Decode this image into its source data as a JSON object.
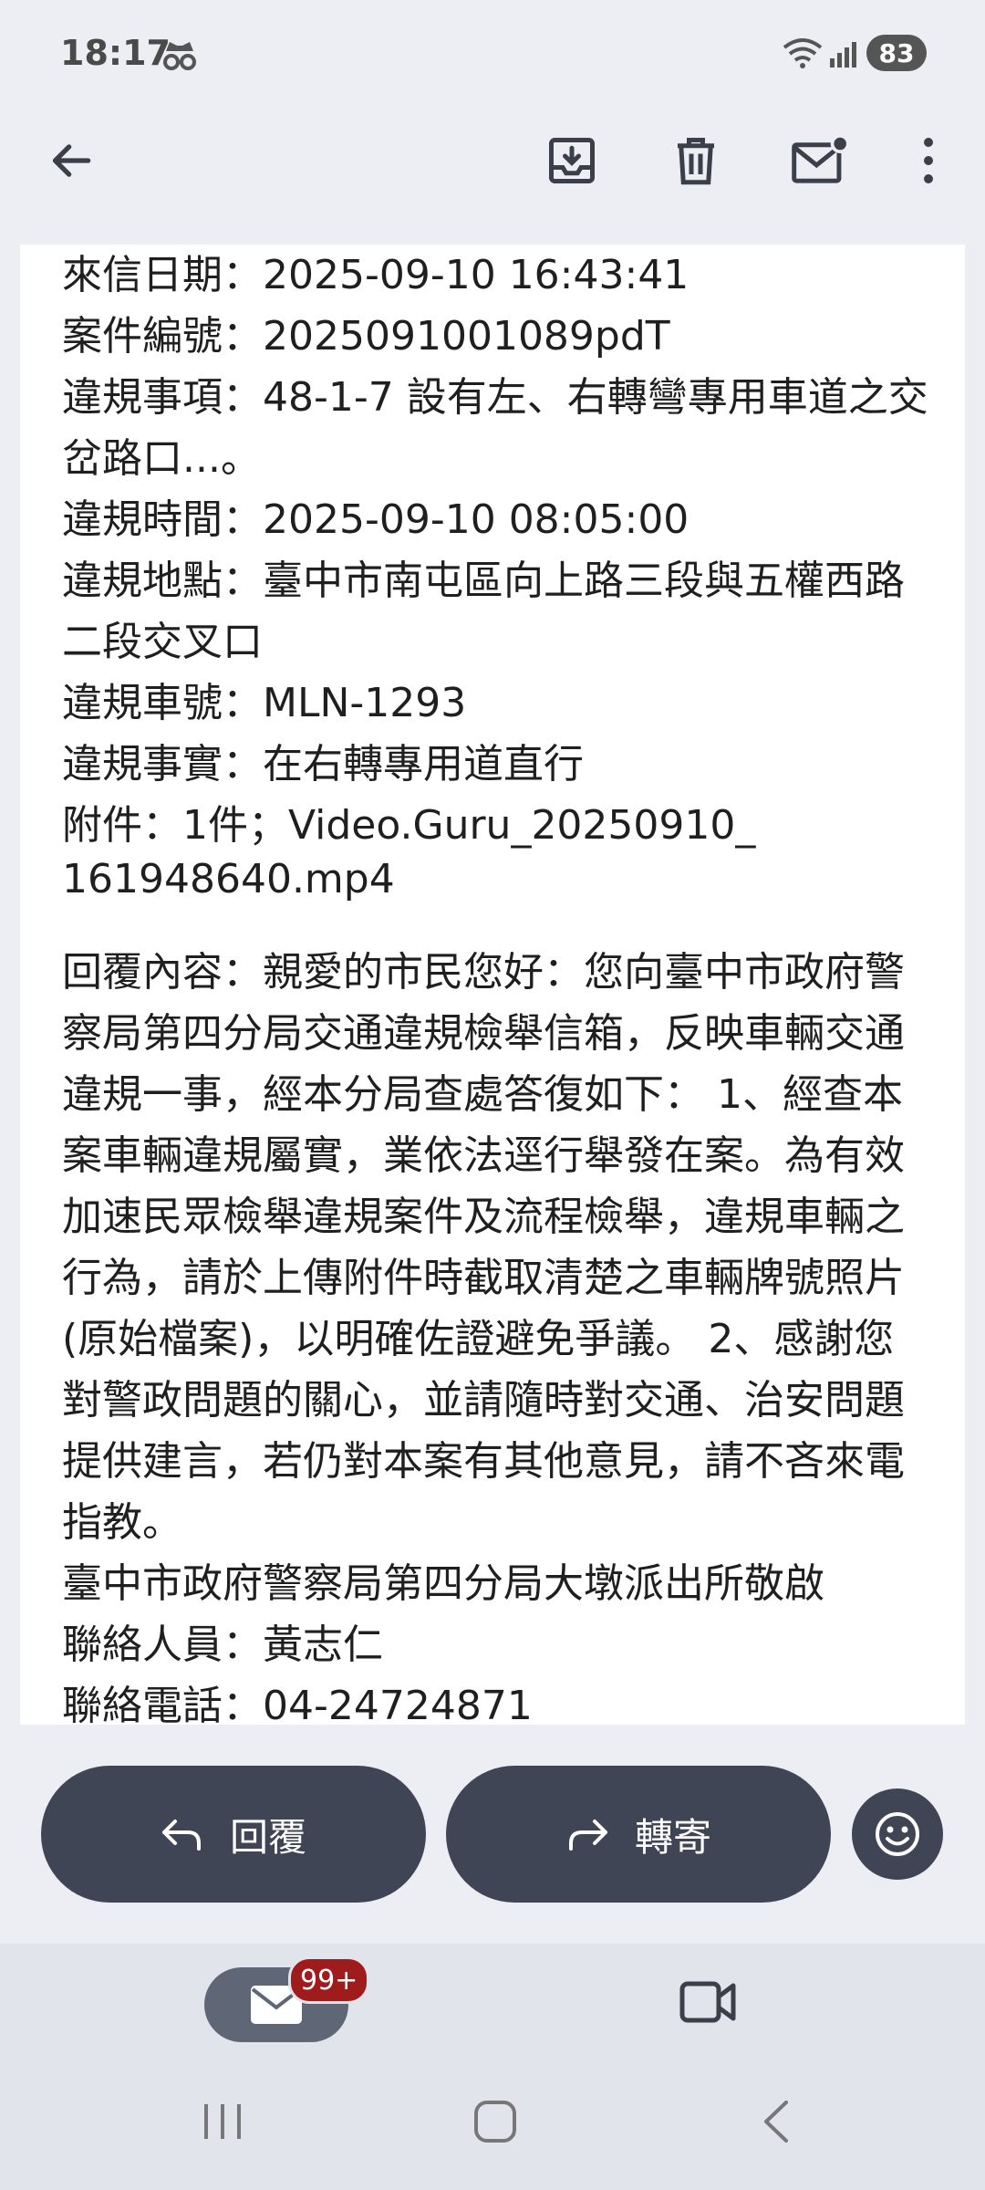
{
  "status_bar": {
    "time": "18:17",
    "battery": "83",
    "icons": [
      "incognito-icon",
      "wifi-icon",
      "signal-icon"
    ]
  },
  "app_bar": {
    "icons": [
      "back-arrow-icon",
      "archive-icon",
      "delete-icon",
      "mark-unread-icon",
      "more-vert-icon"
    ]
  },
  "email": {
    "lines": [
      "來信日期：2025-09-10 16:43:41",
      "案件編號：2025091001089pdT",
      "違規事項：48-1-7 設有左、右轉彎專用車道之交",
      "岔路口...。",
      "違規時間：2025-09-10 08:05:00",
      "違規地點：臺中市南屯區向上路三段與五權西路",
      "二段交叉口",
      "違規車號：MLN-1293",
      "違規事實：在右轉專用道直行",
      "附件：1件；Video.Guru_20250910_",
      "161948640.mp4"
    ],
    "reply_lines": [
      "回覆內容：親愛的市民您好：您向臺中市政府警",
      "察局第四分局交通違規檢舉信箱，反映車輛交通",
      "違規一事，經本分局查處答復如下： 1、經查本",
      "案車輛違規屬實，業依法逕行舉發在案。為有效",
      "加速民眾檢舉違規案件及流程檢舉，違規車輛之",
      "行為，請於上傳附件時截取清楚之車輛牌號照片",
      "(原始檔案)，以明確佐證避免爭議。 2、感謝您",
      "對警政問題的關心，並請隨時對交通、治安問題",
      "提供建言，若仍對本案有其他意見，請不吝來電",
      "指教。",
      "臺中市政府警察局第四分局大墩派出所敬啟",
      "聯絡人員：黃志仁",
      "聯絡電話：04-24724871"
    ]
  },
  "actions": {
    "reply_label": "回覆",
    "forward_label": "轉寄",
    "emoji_icon": "emoji-icon"
  },
  "bottom_nav": {
    "mail_badge": "99+",
    "icons": [
      "mail-icon",
      "video-icon"
    ]
  },
  "system_nav": {
    "icons": [
      "recents-icon",
      "home-icon",
      "back-icon"
    ]
  }
}
